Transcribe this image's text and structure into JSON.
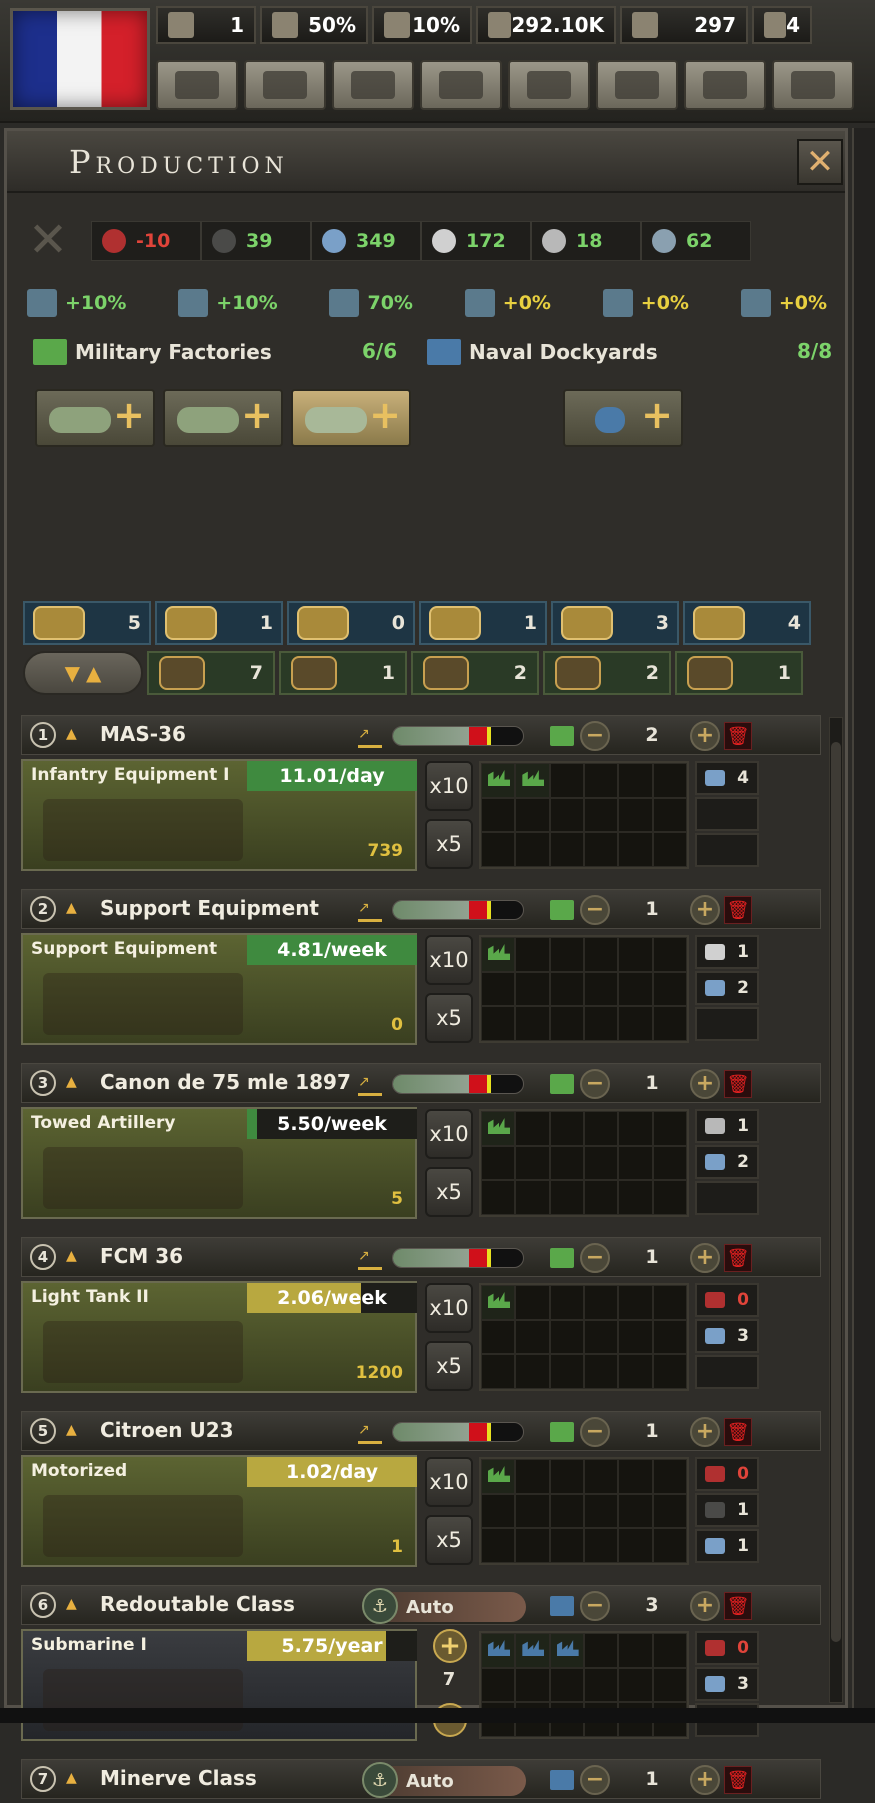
{
  "topbar": {
    "country_flag": "France",
    "stats": [
      {
        "icon": "political-power-icon",
        "value": "1"
      },
      {
        "icon": "stability-icon",
        "value": "50%"
      },
      {
        "icon": "war-support-icon",
        "value": "10%"
      },
      {
        "icon": "manpower-icon",
        "value": "292.10K"
      },
      {
        "icon": "convoys-icon",
        "value": "297"
      },
      {
        "icon": "factories-icon",
        "value": "4"
      }
    ],
    "decision_buttons": [
      "politics-icon",
      "research-icon",
      "diplomacy-icon",
      "trade-icon",
      "construction-icon",
      "production-icon",
      "recruit-icon",
      "logistics-icon"
    ]
  },
  "panel": {
    "title": "Production",
    "resources": [
      {
        "icon": "oil-icon",
        "value": "-10",
        "color": "#e0443a"
      },
      {
        "icon": "rubber-icon",
        "value": "39",
        "color": "#7cd36a"
      },
      {
        "icon": "steel-icon",
        "value": "349",
        "color": "#7cd36a"
      },
      {
        "icon": "aluminium-icon",
        "value": "172",
        "color": "#7cd36a"
      },
      {
        "icon": "tungsten-icon",
        "value": "18",
        "color": "#7cd36a"
      },
      {
        "icon": "chromium-icon",
        "value": "62",
        "color": "#7cd36a"
      }
    ],
    "bonuses": [
      {
        "icon": "dockyard-output-icon",
        "value": "+10%",
        "color": "#7cd36a"
      },
      {
        "icon": "factory-output-icon",
        "value": "+10%",
        "color": "#7cd36a"
      },
      {
        "icon": "production-efficiency-cap-icon",
        "value": "70%",
        "color": "#7cd36a"
      },
      {
        "icon": "efficiency-retention-icon",
        "value": "+0%",
        "color": "#e8d040"
      },
      {
        "icon": "efficiency-growth-icon",
        "value": "+0%",
        "color": "#e8d040"
      },
      {
        "icon": "equipment-conversion-icon",
        "value": "+0%",
        "color": "#e8d040"
      }
    ],
    "military": {
      "label": "Military Factories",
      "count": "6/6"
    },
    "naval": {
      "label": "Naval Dockyards",
      "count": "8/8"
    },
    "filters": [
      {
        "icon": "land-equipment-icon",
        "value": "5"
      },
      {
        "icon": "armor-icon",
        "value": "1"
      },
      {
        "icon": "air-icon",
        "value": "0"
      },
      {
        "icon": "naval-icon",
        "value": "1"
      },
      {
        "icon": "anchor-icon",
        "value": "3"
      },
      {
        "icon": "ship-icon",
        "value": "4"
      }
    ],
    "filters2": [
      {
        "icon": "refit-icon",
        "value": "7"
      },
      {
        "icon": "upgrade-icon",
        "value": "1"
      },
      {
        "icon": "stockpile-icon",
        "value": "2"
      },
      {
        "icon": "reinforce-icon",
        "value": "2"
      },
      {
        "icon": "priority-icon",
        "value": "1"
      }
    ]
  },
  "queue": [
    {
      "num": "1",
      "name": "MAS-36",
      "mode": "factory",
      "factories": "2",
      "equipment": "Infantry Equipment I",
      "rate": "11.01/day",
      "rate_fill": 1.0,
      "rate_color": "#3f8a3f",
      "stockpile": "739",
      "filled_slots": 2,
      "req": [
        {
          "icon": "steel-icon",
          "value": "4"
        },
        {
          "icon": "",
          "value": ""
        },
        {
          "icon": "",
          "value": ""
        }
      ],
      "efficiency": 0.72
    },
    {
      "num": "2",
      "name": "Support Equipment",
      "mode": "factory",
      "factories": "1",
      "equipment": "Support Equipment",
      "rate": "4.81/week",
      "rate_fill": 1.0,
      "rate_color": "#3f8a3f",
      "stockpile": "0",
      "filled_slots": 1,
      "req": [
        {
          "icon": "aluminium-icon",
          "value": "1"
        },
        {
          "icon": "steel-icon",
          "value": "2"
        },
        {
          "icon": "",
          "value": ""
        }
      ],
      "efficiency": 0.72
    },
    {
      "num": "3",
      "name": "Canon de 75 mle 1897",
      "mode": "factory",
      "factories": "1",
      "equipment": "Towed Artillery",
      "rate": "5.50/week",
      "rate_fill": 0.06,
      "rate_color": "#3f8a3f",
      "stockpile": "5",
      "filled_slots": 1,
      "req": [
        {
          "icon": "tungsten-icon",
          "value": "1"
        },
        {
          "icon": "steel-icon",
          "value": "2"
        },
        {
          "icon": "",
          "value": ""
        }
      ],
      "efficiency": 0.72
    },
    {
      "num": "4",
      "name": "FCM 36",
      "mode": "factory",
      "factories": "1",
      "equipment": "Light Tank II",
      "rate": "2.06/week",
      "rate_fill": 0.67,
      "rate_color": "#b8a840",
      "stockpile": "1200",
      "filled_slots": 1,
      "req": [
        {
          "icon": "oil-icon",
          "value": "0",
          "color": "#e0443a"
        },
        {
          "icon": "steel-icon",
          "value": "3"
        },
        {
          "icon": "",
          "value": ""
        }
      ],
      "efficiency": 0.72
    },
    {
      "num": "5",
      "name": "Citroen U23",
      "mode": "factory",
      "factories": "1",
      "equipment": "Motorized",
      "rate": "1.02/day",
      "rate_fill": 1.0,
      "rate_color": "#b8a840",
      "stockpile": "1",
      "filled_slots": 1,
      "req": [
        {
          "icon": "oil-icon",
          "value": "0",
          "color": "#e0443a"
        },
        {
          "icon": "rubber-icon",
          "value": "1"
        },
        {
          "icon": "steel-icon",
          "value": "1"
        }
      ],
      "efficiency": 0.72
    },
    {
      "num": "6",
      "name": "Redoutable Class",
      "mode": "naval",
      "auto": "Auto",
      "factories": "3",
      "equipment": "Submarine I",
      "rate": "5.75/year",
      "rate_fill": 0.82,
      "rate_color": "#b8a840",
      "ships": "7",
      "filled_slots": 3,
      "req": [
        {
          "icon": "oil-icon",
          "value": "0",
          "color": "#e0443a"
        },
        {
          "icon": "steel-icon",
          "value": "3"
        },
        {
          "icon": "",
          "value": ""
        }
      ]
    },
    {
      "num": "7",
      "name": "Minerve Class",
      "mode": "naval",
      "auto": "Auto",
      "factories": "1"
    }
  ]
}
